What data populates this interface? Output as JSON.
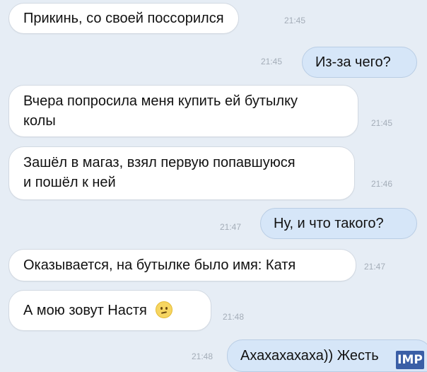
{
  "messages": [
    {
      "text": "Прикинь, со своей поссорился",
      "time": "21:45"
    },
    {
      "text": "Из-за чего?",
      "time": "21:45"
    },
    {
      "line1": "Вчера попросила меня купить ей бутылку",
      "line2": "колы",
      "time": "21:45"
    },
    {
      "line1": "Зашёл в магаз, взял первую попавшуюся",
      "line2": "и пошёл к ней",
      "time": "21:46"
    },
    {
      "text": "Ну, и что такого?",
      "time": "21:47"
    },
    {
      "text": "Оказывается, на бутылке было имя: Катя",
      "time": "21:47"
    },
    {
      "text": "А мою зовут Настя",
      "emoji": "confused-face-emoji",
      "time": "21:48"
    },
    {
      "text": "Ахахахахаха)) Жесть",
      "time": "21:48"
    }
  ],
  "watermark": {
    "text": "IMP"
  }
}
